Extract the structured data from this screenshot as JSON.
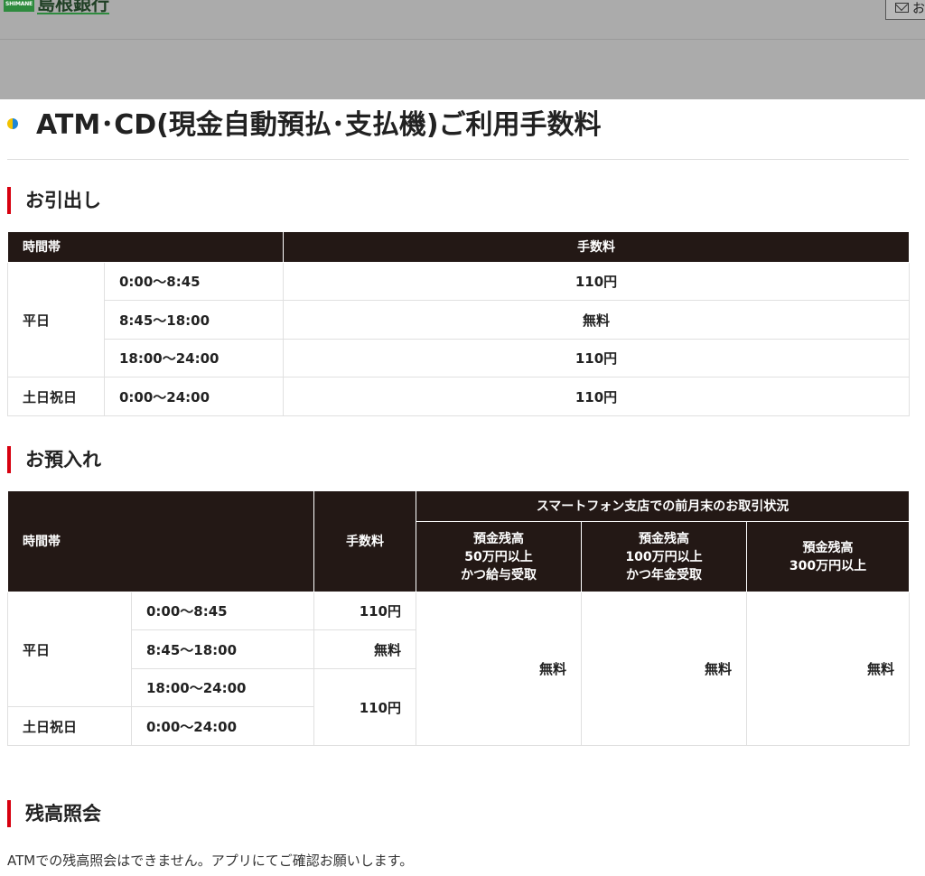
{
  "header": {
    "logo_mark": "SHIMANE",
    "logo_text": "島根銀行",
    "contact_label": "お"
  },
  "page_title": "ATM･CD(現金自動預払･支払機)ご利用手数料",
  "withdrawal": {
    "heading": "お引出し",
    "col_time": "時間帯",
    "col_fee": "手数料",
    "rows": [
      {
        "day": "平日",
        "time": "0:00～8:45",
        "fee": "110円"
      },
      {
        "day": "",
        "time": "8:45～18:00",
        "fee": "無料"
      },
      {
        "day": "",
        "time": "18:00～24:00",
        "fee": "110円"
      },
      {
        "day": "土日祝日",
        "time": "0:00～24:00",
        "fee": "110円"
      }
    ]
  },
  "deposit": {
    "heading": "お預入れ",
    "col_time": "時間帯",
    "col_fee": "手数料",
    "col_status": "スマートフォン支店での前月末のお取引状況",
    "col_tier1_line1": "預金残高",
    "col_tier1_line2": "50万円以上",
    "col_tier1_line3": "かつ給与受取",
    "col_tier2_line1": "預金残高",
    "col_tier2_line2": "100万円以上",
    "col_tier2_line3": "かつ年金受取",
    "col_tier3_line1": "預金残高",
    "col_tier3_line2": "300万円以上",
    "rows": [
      {
        "day": "平日",
        "time": "0:00～8:45",
        "fee": "110円"
      },
      {
        "day": "",
        "time": "8:45～18:00",
        "fee": "無料"
      },
      {
        "day": "",
        "time": "18:00～24:00",
        "fee": "110円"
      },
      {
        "day": "土日祝日",
        "time": "0:00～24:00",
        "fee": ""
      }
    ],
    "tier1_fee": "無料",
    "tier2_fee": "無料",
    "tier3_fee": "無料"
  },
  "balance": {
    "heading": "残高照会",
    "note": "ATMでの残高照会はできません。アプリにてご確認お願いします。"
  },
  "colors": {
    "header_bg": "#ababab",
    "table_header_bg": "#231815",
    "accent_red": "#d7000f"
  }
}
